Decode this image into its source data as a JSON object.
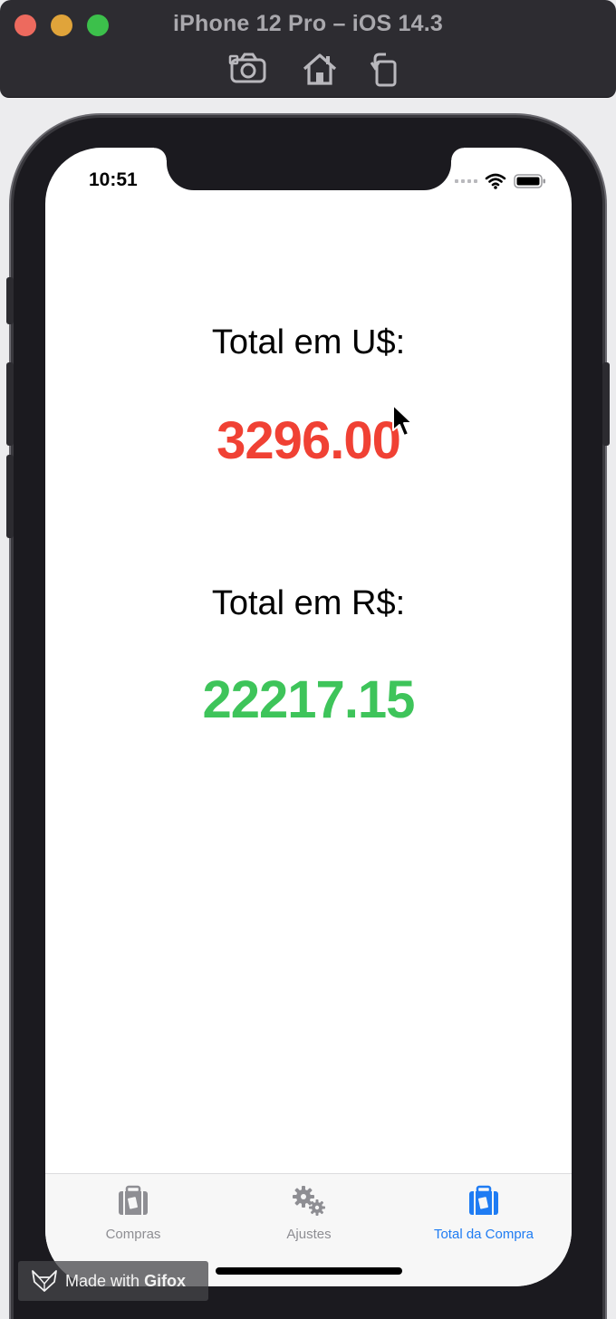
{
  "window": {
    "title": "iPhone 12 Pro – iOS 14.3"
  },
  "status_bar": {
    "time": "10:51"
  },
  "content": {
    "usd_label": "Total em U$:",
    "usd_value": "3296.00",
    "brl_label": "Total em R$:",
    "brl_value": "22217.15"
  },
  "tabbar": {
    "tabs": [
      {
        "label": "Compras",
        "icon": "suitcase-icon",
        "active": false
      },
      {
        "label": "Ajustes",
        "icon": "gears-icon",
        "active": false
      },
      {
        "label": "Total da Compra",
        "icon": "suitcase-icon",
        "active": true
      }
    ]
  },
  "watermark": {
    "prefix": "Made with",
    "brand": "Gifox"
  },
  "colors": {
    "usd_value": "#f04134",
    "brl_value": "#3ec45a",
    "tab_active": "#1f7cf3",
    "tab_inactive": "#8e8e93"
  }
}
